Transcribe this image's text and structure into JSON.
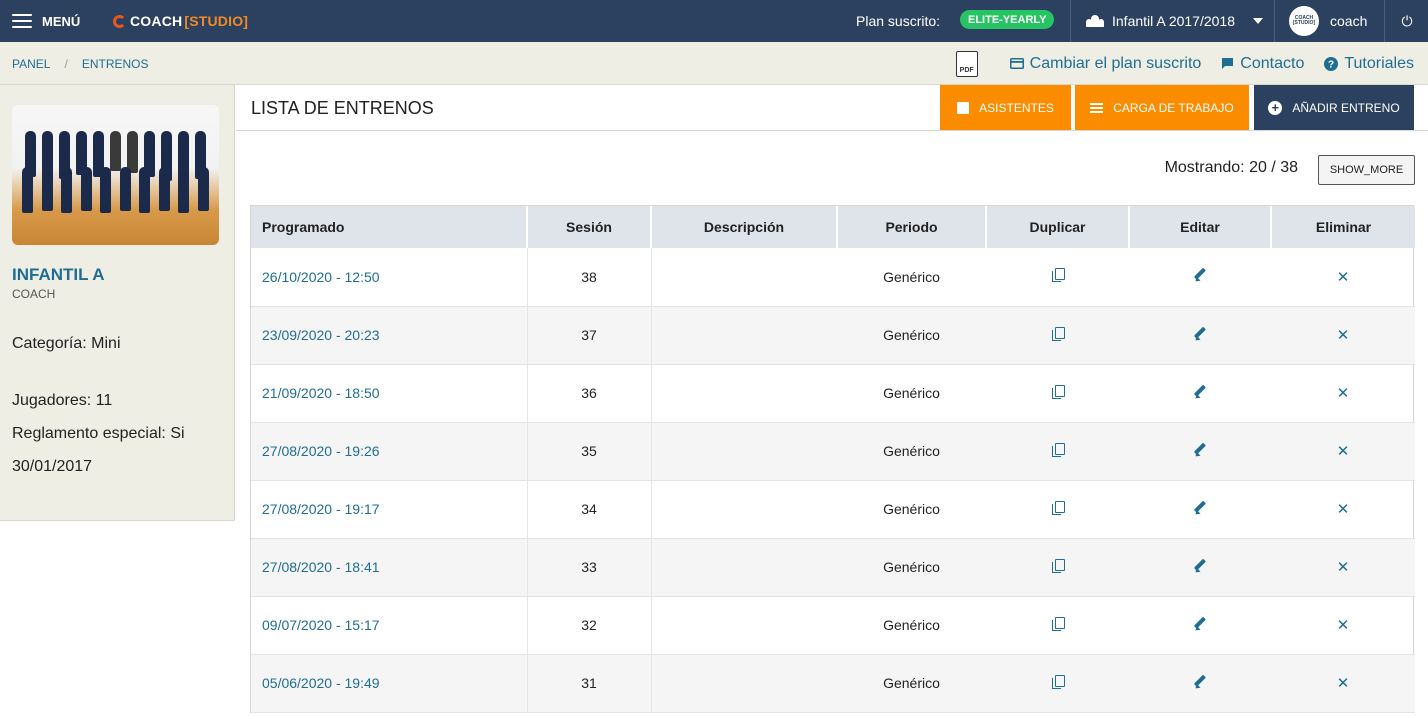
{
  "topbar": {
    "menu_label": "MENÚ",
    "logo_main": "COACH",
    "logo_studio": "[STUDIO]",
    "plan_label": "Plan suscrito:",
    "plan_badge": "ELITE-YEARLY",
    "team_selector": "Infantil A 2017/2018",
    "avatar_text": "COACH [STUDIO]",
    "user_name": "coach",
    "power_glyph": "⏻"
  },
  "breadcrumb": {
    "items": [
      "PANEL",
      "ENTRENOS"
    ],
    "separator": "/"
  },
  "tools": {
    "pdf_label": "PDF",
    "change_plan": "Cambiar el plan suscrito",
    "contact": "Contacto",
    "tutorials": "Tutoriales"
  },
  "sidebar": {
    "team_name": "INFANTIL A",
    "role": "COACH",
    "category": "Categoría: Mini",
    "players": "Jugadores: 11",
    "special_rules": "Reglamento especial: Si",
    "date": "30/01/2017"
  },
  "main": {
    "title": "LISTA DE ENTRENOS",
    "btn_attendees": "ASISTENTES",
    "btn_workload": "CARGA DE TRABAJO",
    "btn_add": "AÑADIR ENTRENO",
    "showing": "Mostrando: 20 / 38",
    "show_more": "SHOW_MORE"
  },
  "table": {
    "headers": {
      "programado": "Programado",
      "sesion": "Sesión",
      "descripcion": "Descripción",
      "periodo": "Periodo",
      "duplicar": "Duplicar",
      "editar": "Editar",
      "eliminar": "Eliminar"
    },
    "rows": [
      {
        "programado": "26/10/2020 - 12:50",
        "sesion": "38",
        "descripcion": "",
        "periodo": "Genérico"
      },
      {
        "programado": "23/09/2020 - 20:23",
        "sesion": "37",
        "descripcion": "",
        "periodo": "Genérico"
      },
      {
        "programado": "21/09/2020 - 18:50",
        "sesion": "36",
        "descripcion": "",
        "periodo": "Genérico"
      },
      {
        "programado": "27/08/2020 - 19:26",
        "sesion": "35",
        "descripcion": "",
        "periodo": "Genérico"
      },
      {
        "programado": "27/08/2020 - 19:17",
        "sesion": "34",
        "descripcion": "",
        "periodo": "Genérico"
      },
      {
        "programado": "27/08/2020 - 18:41",
        "sesion": "33",
        "descripcion": "",
        "periodo": "Genérico"
      },
      {
        "programado": "09/07/2020 - 15:17",
        "sesion": "32",
        "descripcion": "",
        "periodo": "Genérico"
      },
      {
        "programado": "05/06/2020 - 19:49",
        "sesion": "31",
        "descripcion": "",
        "periodo": "Genérico"
      }
    ],
    "delete_glyph": "✕"
  },
  "colors": {
    "topbar": "#2c4160",
    "accent_orange": "#fb8c00",
    "badge_green": "#27c463",
    "link_blue": "#1f6d93",
    "panel_beige": "#efeee5"
  }
}
